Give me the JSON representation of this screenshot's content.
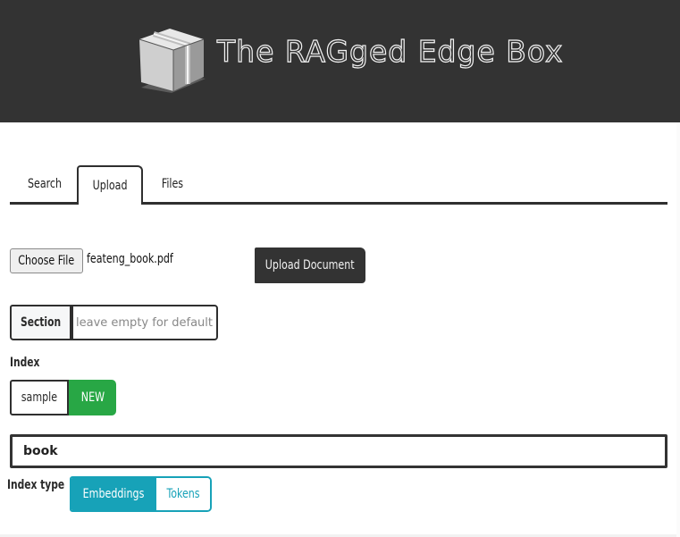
{
  "header": {
    "title": "The RAGged Edge Box",
    "logo_icon": "cardboard-box-icon",
    "background": "#333333"
  },
  "tabs": [
    {
      "label": "Search",
      "active": false
    },
    {
      "label": "Upload",
      "active": true
    },
    {
      "label": "Files",
      "active": false
    }
  ],
  "upload": {
    "choose_file_label": "Choose File",
    "file_name": "feateng_book.pdf",
    "upload_button_label": "Upload Document"
  },
  "section": {
    "label": "Section",
    "value": "",
    "placeholder": "leave empty for default"
  },
  "index": {
    "label": "Index",
    "options": [
      {
        "label": "sample",
        "selected": false
      },
      {
        "label": "NEW",
        "selected": true
      }
    ],
    "new_name_value": "book",
    "accent": "#28a745"
  },
  "index_type": {
    "label": "Index type",
    "options": [
      {
        "label": "Embeddings",
        "selected": true
      },
      {
        "label": "Tokens",
        "selected": false
      }
    ],
    "accent": "#17a2b8"
  }
}
